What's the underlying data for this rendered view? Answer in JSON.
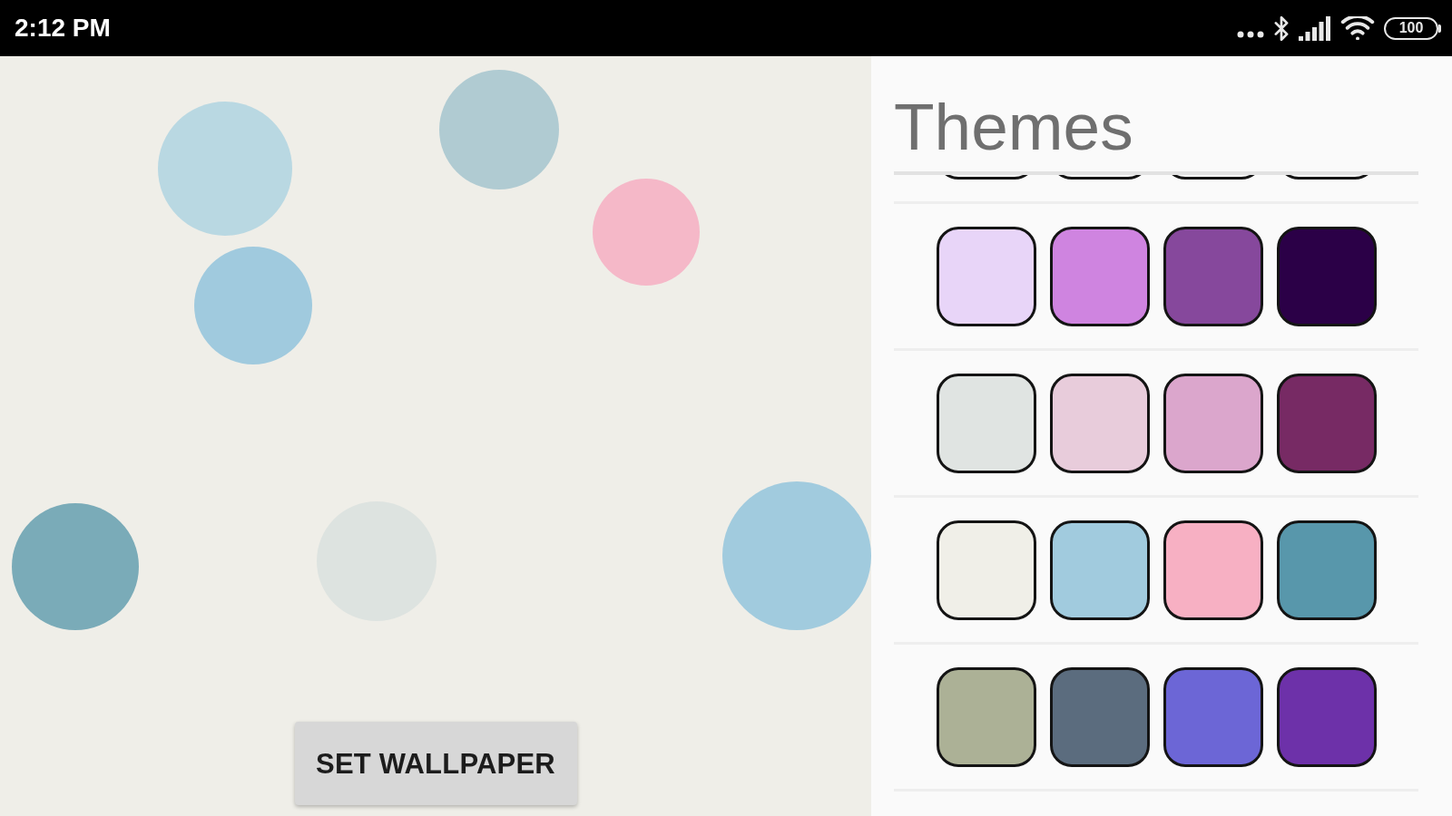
{
  "status_bar": {
    "time": "2:12 PM",
    "battery": "100"
  },
  "wallpaper_preview": {
    "button": "SET WALLPAPER"
  },
  "themes": {
    "title": "Themes",
    "palettes": [
      {
        "swatches": [
          {
            "color": "#e8d5f8"
          },
          {
            "color": "#cf84e0"
          },
          {
            "color": "#86489c"
          },
          {
            "color": "#2b0047"
          }
        ]
      },
      {
        "swatches": [
          {
            "color": "#e0e4e2"
          },
          {
            "color": "#e8ccdb"
          },
          {
            "color": "#dba6cc"
          },
          {
            "color": "#772a64"
          }
        ]
      },
      {
        "swatches": [
          {
            "color": "#f0efe8"
          },
          {
            "color": "#a1cbde"
          },
          {
            "color": "#f7b0c3"
          },
          {
            "color": "#5897ab"
          }
        ]
      },
      {
        "swatches": [
          {
            "color": "#acb196"
          },
          {
            "color": "#5b6c7e"
          },
          {
            "color": "#6c66d6"
          },
          {
            "color": "#6d31a9"
          }
        ]
      }
    ]
  }
}
